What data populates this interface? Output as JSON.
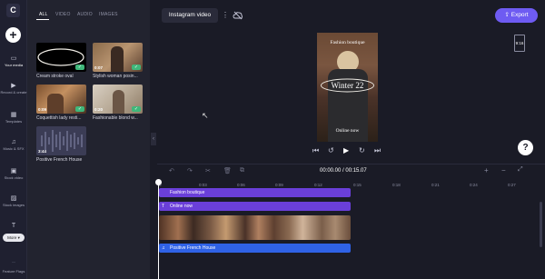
{
  "app": {
    "logo_letter": "C"
  },
  "nav": {
    "items": [
      {
        "label": "Your media",
        "icon": "folder-icon",
        "glyph": "▭"
      },
      {
        "label": "Record & create",
        "icon": "camera-icon",
        "glyph": "▶"
      },
      {
        "label": "Templates",
        "icon": "templates-icon",
        "glyph": "▦"
      },
      {
        "label": "Music & SFX",
        "icon": "music-icon",
        "glyph": "♫"
      },
      {
        "label": "Stock video",
        "icon": "stock-video-icon",
        "glyph": "▣"
      },
      {
        "label": "Stock images",
        "icon": "stock-images-icon",
        "glyph": "▨"
      },
      {
        "label": "Text",
        "icon": "text-icon",
        "glyph": "T"
      }
    ],
    "more_label": "More",
    "bottom_label": "Feature Flags"
  },
  "media": {
    "tabs": [
      "ALL",
      "VIDEO",
      "AUDIO",
      "IMAGES"
    ],
    "items": [
      {
        "label": "Cream stroke oval",
        "duration": ""
      },
      {
        "label": "Stylish woman posin...",
        "duration": "0:07"
      },
      {
        "label": "Coquettish lady resti...",
        "duration": "0:09"
      },
      {
        "label": "Fashionable blond w...",
        "duration": "0:20"
      },
      {
        "label": "Positive French House",
        "duration": "3:44"
      }
    ]
  },
  "header": {
    "project_name": "Instagram video",
    "menu_glyph": "⋮",
    "export_label": "Export"
  },
  "preview": {
    "top_text": "Fashion boutique",
    "title": "Winter 22",
    "bottom_text": "Online now",
    "ratio": "9:16"
  },
  "help_label": "?",
  "timeline": {
    "time_current": "00:00.00",
    "time_total": "00:15.07",
    "ticks": [
      "0",
      "0:03",
      "0:06",
      "0:09",
      "0:12",
      "0:15",
      "0:18",
      "0:21",
      "0:24",
      "0:27"
    ],
    "tracks": [
      {
        "label": "Fashion boutique",
        "color": "#6a3fd9"
      },
      {
        "label": "Online now",
        "color": "#6a3fd9"
      },
      {
        "label": "Positive French House",
        "color": "#2f62e6"
      }
    ]
  },
  "colors": {
    "accent": "#6e5bf2",
    "check": "#3fb77a",
    "audio": "#2f62e6"
  }
}
